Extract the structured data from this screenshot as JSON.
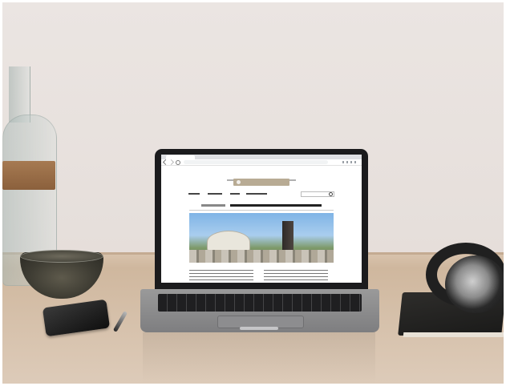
{
  "scene": {
    "objects": [
      "vase",
      "glass-bowl",
      "smartphone",
      "pen",
      "laptop",
      "notebook",
      "headphones"
    ],
    "colors": {
      "wall": "#e7e0dc",
      "desk": "#d4bea7",
      "laptop_body": "#8a8a8c",
      "bezel": "#1b1b1d",
      "accent_logo": "#b8ab94"
    }
  },
  "laptop_screen": {
    "browser": {
      "icons": [
        "back-icon",
        "forward-icon",
        "reload-icon",
        "menu-dots-icon"
      ]
    },
    "website": {
      "icons": [
        "logo-icon",
        "search-icon"
      ]
    }
  }
}
